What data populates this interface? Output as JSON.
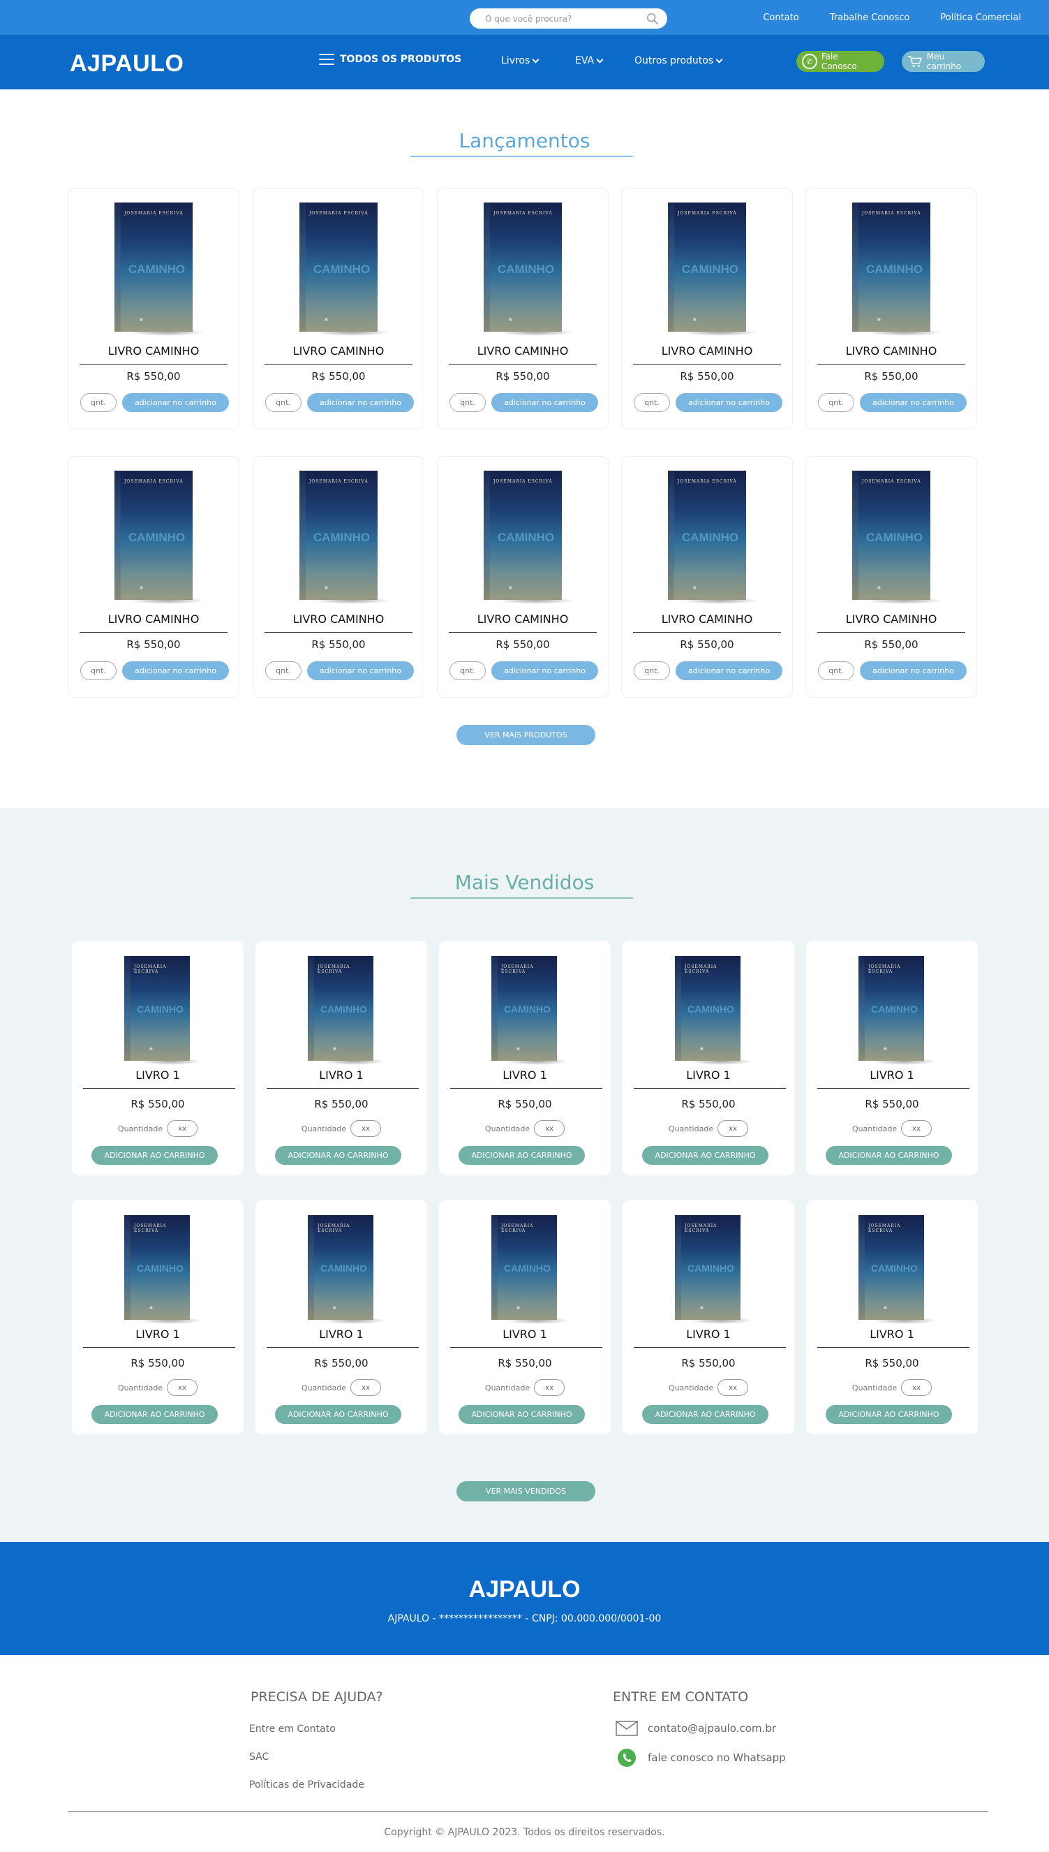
{
  "topbar": {
    "search_placeholder": "O que você procura?",
    "links": [
      "Contato",
      "Trabalhe Conosco",
      "Política Comercial"
    ]
  },
  "navbar": {
    "logo": "AJPAULO",
    "all_products": "TODOS OS PRODUTOS",
    "menu": [
      "Livros",
      "EVA",
      "Outros produtos"
    ],
    "whatsapp_label": "Fale Conosco",
    "cart_label": "Meu carrinho"
  },
  "book_cover": {
    "author": "JOSEMARIA ESCRIVÁ",
    "title": "CAMINHO"
  },
  "lancamentos": {
    "title": "Lançamentos",
    "product_name": "LIVRO CAMINHO",
    "price": "R$ 550,00",
    "qnt_label": "qnt.",
    "add_label": "adicionar no carrinho",
    "more_label": "VER MAIS PRODUTOS"
  },
  "mais_vendidos": {
    "title": "Mais Vendidos",
    "product_name": "LIVRO 1",
    "price": "R$ 550,00",
    "qty_label": "Quantidade",
    "qty_value": "xx",
    "add_label": "ADICIONAR AO CARRINHO",
    "more_label": "VER MAIS VENDIDOS"
  },
  "footer": {
    "logo": "AJPAULO",
    "company_line": "AJPAULO - ***************** - CNPJ: 00.000.000/0001-00",
    "help_title": "PRECISA DE AJUDA?",
    "help_links": [
      "Entre em Contato",
      "SAC",
      "Políticas de Privacidade"
    ],
    "contact_title": "ENTRE EM CONTATO",
    "email": "contato@ajpaulo.com.br",
    "whatsapp": "fale conosco no Whatsapp",
    "copyright": "Copyright © AJPAULO 2023. Todos os direitos reservados."
  },
  "colors": {
    "topbar": "#2a86da",
    "navbar": "#0c6bc8",
    "lancamentos_accent": "#5aa8d8",
    "mais_vendidos_accent": "#6aafa5",
    "whatsapp_green": "#6fb23a"
  }
}
